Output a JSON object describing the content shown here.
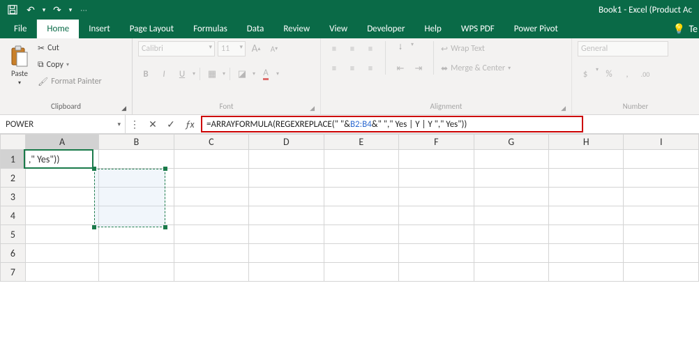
{
  "title": "Book1  -  Excel (Product Ac",
  "qat": {
    "save": "💾",
    "undo": "↶",
    "redo": "↷",
    "more": "▾"
  },
  "tabs": {
    "file": "File",
    "items": [
      "Home",
      "Insert",
      "Page Layout",
      "Formulas",
      "Data",
      "Review",
      "View",
      "Developer",
      "Help",
      "WPS PDF",
      "Power Pivot"
    ],
    "tell_icon": "💡",
    "tell_label": "Te"
  },
  "ribbon": {
    "clipboard": {
      "label": "Clipboard",
      "paste": "Paste",
      "cut": "Cut",
      "copy": "Copy",
      "format_painter": "Format Painter"
    },
    "font": {
      "label": "Font",
      "name": "Calibri",
      "size": "11",
      "inc": "A▴",
      "dec": "A▾",
      "bold": "B",
      "italic": "I",
      "underline": "U",
      "border": "▦",
      "fill": "◪",
      "color": "A"
    },
    "alignment": {
      "label": "Alignment",
      "wrap": "Wrap Text",
      "merge": "Merge & Center"
    },
    "number": {
      "label": "Number",
      "format": "General"
    }
  },
  "namebox": "POWER",
  "formula": {
    "pre": "=ARRAYFORMULA(REGEXREPLACE(\" \"&",
    "ref": "B2:B4",
    "post": "&\" \",\" Yes | Y | Y \",\" Yes\"))"
  },
  "grid": {
    "cols": [
      "A",
      "B",
      "C",
      "D",
      "E",
      "F",
      "G",
      "H",
      "I"
    ],
    "rows": [
      "1",
      "2",
      "3",
      "4",
      "5",
      "6",
      "7"
    ],
    "cells": {
      "A1": ",\" Yes\"))"
    }
  }
}
